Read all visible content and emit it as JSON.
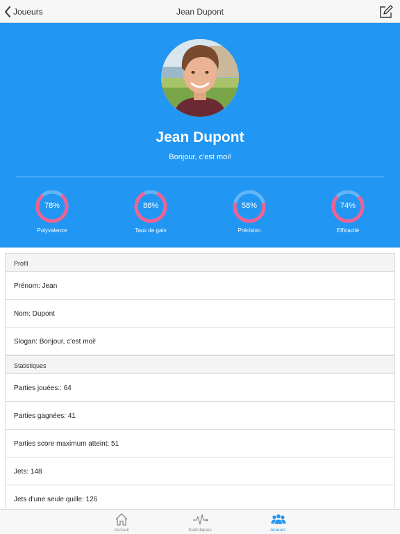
{
  "colors": {
    "accent": "#2196f3",
    "gauge_ring": "#f06292",
    "gauge_track": "#64b5f6"
  },
  "navbar": {
    "back_label": "Joueurs",
    "title": "Jean Dupont",
    "edit_icon": "edit-icon"
  },
  "hero": {
    "name": "Jean Dupont",
    "slogan": "Bonjour, c'est moi!",
    "gauges": [
      {
        "value": "78%",
        "fraction": 0.78,
        "label": "Polyvalence"
      },
      {
        "value": "86%",
        "fraction": 0.86,
        "label": "Taux de gain"
      },
      {
        "value": "58%",
        "fraction": 0.58,
        "label": "Précision"
      },
      {
        "value": "74%",
        "fraction": 0.74,
        "label": "Efficacité"
      }
    ]
  },
  "profile": {
    "header": "Profil",
    "rows": [
      {
        "label": "Prénom: ",
        "value": "Jean"
      },
      {
        "label": "Nom: ",
        "value": "Dupont"
      },
      {
        "label": "Slogan: ",
        "value": "Bonjour, c'est moi!"
      }
    ]
  },
  "stats": {
    "header": "Statistiques",
    "rows": [
      {
        "label": "Parties jouées:: ",
        "value": "64"
      },
      {
        "label": "Parties gagnées: ",
        "value": "41"
      },
      {
        "label": "Parties score maximum atteint: ",
        "value": "51"
      },
      {
        "label": "Jets: ",
        "value": "148"
      },
      {
        "label": "Jets d'une seule quille: ",
        "value": "126"
      }
    ]
  },
  "tabbar": {
    "tabs": [
      {
        "label": "Accueil",
        "icon": "home-icon",
        "active": false
      },
      {
        "label": "Statistiques",
        "icon": "pulse-icon",
        "active": false
      },
      {
        "label": "Joueurs",
        "icon": "people-icon",
        "active": true
      }
    ]
  }
}
